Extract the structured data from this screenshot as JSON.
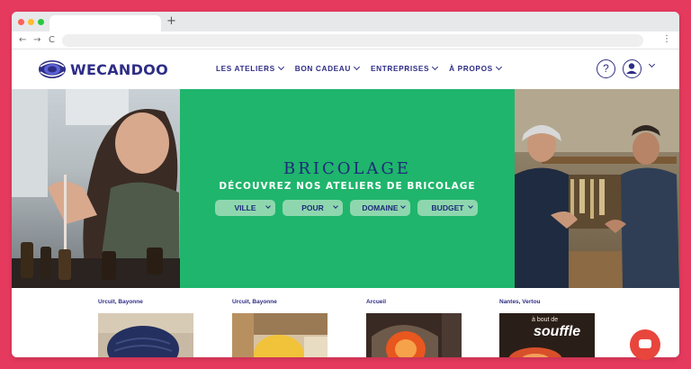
{
  "browser": {
    "new_tab_symbol": "+",
    "back_symbol": "←",
    "forward_symbol": "→",
    "reload_symbol": "C",
    "menu_symbol": "⋮"
  },
  "brand": {
    "name": "WECANDOO",
    "color": "#2e2d86"
  },
  "nav": {
    "items": [
      {
        "label": "LES ATELIERS"
      },
      {
        "label": "BON CADEAU"
      },
      {
        "label": "ENTREPRISES"
      },
      {
        "label": "À PROPOS"
      }
    ],
    "help_symbol": "?"
  },
  "hero": {
    "title": "BRICOLAGE",
    "subtitle": "DÉCOUVREZ NOS ATELIERS DE BRICOLAGE",
    "filters": [
      {
        "label": "VILLE"
      },
      {
        "label": "POUR"
      },
      {
        "label": "DOMAINE"
      },
      {
        "label": "BUDGET"
      }
    ],
    "accent": "#1fb56c"
  },
  "cards": [
    {
      "location": "Urcuit, Bayonne"
    },
    {
      "location": "Urcuit, Bayonne"
    },
    {
      "location": "Arcueil"
    },
    {
      "location": "Nantes, Vertou",
      "image_text_small": "à bout de",
      "image_text_big": "souffle"
    }
  ]
}
